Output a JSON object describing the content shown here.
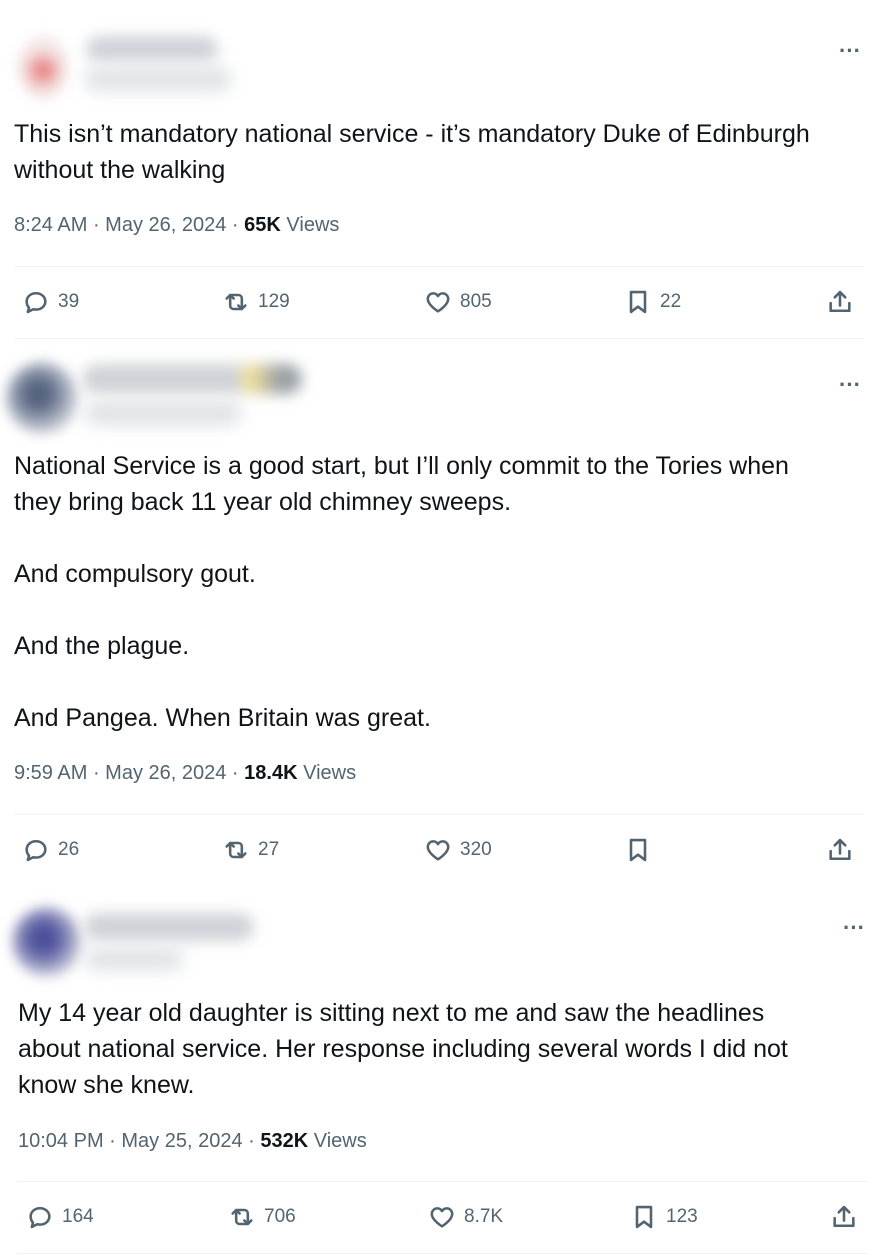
{
  "colors": {
    "text_primary": "#0f1419",
    "text_secondary": "#536471",
    "divider": "#eff3f4"
  },
  "tweets": [
    {
      "text": "This isn’t mandatory national service - it’s mandatory Duke of Edinburgh\nwithout the walking",
      "time": "8:24 AM",
      "sep1": " · ",
      "date": "May 26, 2024",
      "sep2": " · ",
      "views_count": "65K",
      "views_label": " Views",
      "more": "···",
      "replies": "39",
      "reposts": "129",
      "likes": "805",
      "bookmarks": "22"
    },
    {
      "text": "National Service is a good start, but I’ll only commit to the Tories when\nthey bring back 11 year old chimney sweeps.\n\nAnd compulsory gout.\n\nAnd the plague.\n\nAnd Pangea. When Britain was great.",
      "time": "9:59 AM",
      "sep1": " · ",
      "date": "May 26, 2024",
      "sep2": " · ",
      "views_count": "18.4K",
      "views_label": " Views",
      "more": "···",
      "replies": "26",
      "reposts": "27",
      "likes": "320",
      "bookmarks": ""
    },
    {
      "text": "My 14 year old daughter is sitting next to me and saw the headlines\nabout national service. Her response including several words I did not\nknow she knew.",
      "time": "10:04 PM",
      "sep1": " · ",
      "date": "May 25, 2024",
      "sep2": " · ",
      "views_count": "532K",
      "views_label": " Views",
      "more": "···",
      "replies": "164",
      "reposts": "706",
      "likes": "8.7K",
      "bookmarks": "123"
    }
  ],
  "icons": {
    "reply": "reply-icon",
    "repost": "repost-icon",
    "like": "heart-icon",
    "bookmark": "bookmark-icon",
    "share": "share-icon",
    "more": "more-icon"
  }
}
